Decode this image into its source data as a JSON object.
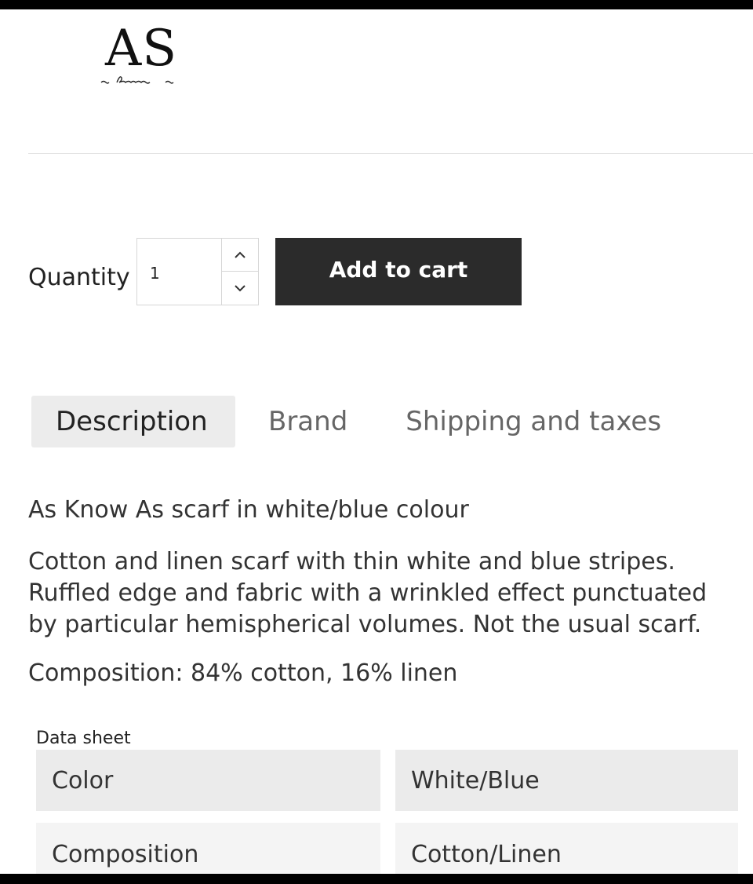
{
  "logo": {
    "main": "AS",
    "sub": "as know as"
  },
  "quantity": {
    "label": "Quantity",
    "value": "1"
  },
  "cart": {
    "add_label": "Add to cart"
  },
  "tabs": [
    {
      "label": "Description",
      "active": true
    },
    {
      "label": "Brand",
      "active": false
    },
    {
      "label": "Shipping and taxes",
      "active": false
    }
  ],
  "description": {
    "title": "As Know As scarf in white/blue colour",
    "lines": [
      "Cotton and linen scarf with thin white and blue stripes.",
      "Ruffled edge and fabric with a wrinkled effect punctuated",
      "by particular hemispherical volumes. Not the usual scarf."
    ],
    "composition": "Composition: 84% cotton, 16% linen"
  },
  "data_sheet": {
    "caption": "Data sheet",
    "rows": [
      {
        "name": "Color",
        "value": "White/Blue"
      },
      {
        "name": "Composition",
        "value": "Cotton/Linen"
      }
    ]
  },
  "colors": {
    "button_bg": "#2b2b2b",
    "active_tab_bg": "#ececec",
    "sheet_row_1": "#ebebeb",
    "sheet_row_2": "#f4f4f4"
  },
  "icons": {
    "stepper_up": "chevron-up-icon",
    "stepper_down": "chevron-down-icon"
  }
}
